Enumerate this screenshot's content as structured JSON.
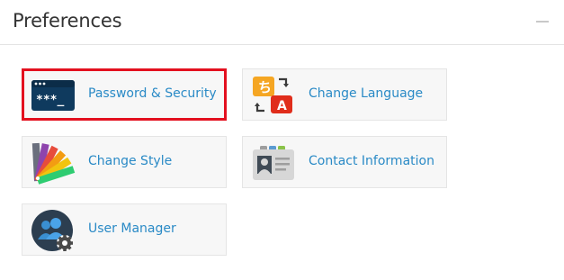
{
  "panel": {
    "title": "Preferences",
    "collapse_label": "collapse"
  },
  "tiles": [
    {
      "label": "Password & Security",
      "icon": "password-terminal-icon",
      "icon_text": "***_",
      "selected": true
    },
    {
      "label": "Change Language",
      "icon": "language-icon",
      "icon_text_a": "ち",
      "icon_text_b": "A",
      "selected": false
    },
    {
      "label": "Change Style",
      "icon": "color-swatches-icon",
      "selected": false
    },
    {
      "label": "Contact Information",
      "icon": "contact-card-icon",
      "selected": false
    },
    {
      "label": "User Manager",
      "icon": "user-manager-icon",
      "selected": false
    }
  ],
  "colors": {
    "link": "#2a8ac6",
    "selected_border": "#e3101f",
    "tile_bg": "#f7f7f7",
    "tile_border": "#e5e5e5"
  }
}
